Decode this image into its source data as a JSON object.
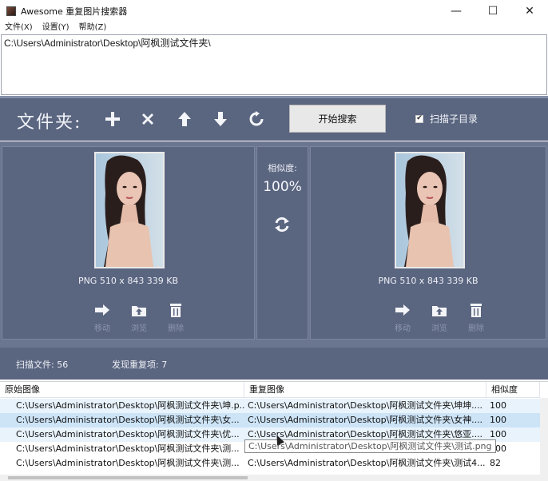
{
  "window": {
    "title": "Awesome 重复图片搜索器",
    "minimize": "—",
    "maximize": "☐",
    "close": "✕"
  },
  "menu": [
    "文件(X)",
    "设置(Y)",
    "帮助(Z)"
  ],
  "folders": [
    "C:\\Users\\Administrator\\Desktop\\阿枫测试文件夹\\"
  ],
  "toolbar": {
    "label": "文件夹:",
    "search_button": "开始搜索",
    "subdir_label": "扫描子目录",
    "subdir_checked": true
  },
  "left_image": {
    "info": "PNG  510 x 843  339 KB",
    "actions": [
      "移动",
      "浏览",
      "删除"
    ]
  },
  "right_image": {
    "info": "PNG  510 x 843  339 KB",
    "actions": [
      "移动",
      "浏览",
      "删除"
    ]
  },
  "similarity": {
    "label": "相似度:",
    "value": "100%"
  },
  "status": {
    "scanned": "扫描文件:  56",
    "duplicates": "发现重复项:  7"
  },
  "table": {
    "headers": [
      "原始图像",
      "重复图像",
      "相似度"
    ],
    "rows": [
      {
        "original": "C:\\Users\\Administrator\\Desktop\\阿枫测试文件夹\\坤.p...",
        "duplicate": "C:\\Users\\Administrator\\Desktop\\阿枫测试文件夹\\坤坤....",
        "similarity": "100"
      },
      {
        "original": "C:\\Users\\Administrator\\Desktop\\阿枫测试文件夹\\女...",
        "duplicate": "C:\\Users\\Administrator\\Desktop\\阿枫测试文件夹\\女神....",
        "similarity": "100"
      },
      {
        "original": "C:\\Users\\Administrator\\Desktop\\阿枫测试文件夹\\优...",
        "duplicate": "C:\\Users\\Administrator\\Desktop\\阿枫测试文件夹\\悠亚....",
        "similarity": "100"
      },
      {
        "original": "C:\\Users\\Administrator\\Desktop\\阿枫测试文件夹\\测...",
        "duplicate": "C:\\Users\\Administrator\\Desktop\\阿枫测试文件夹\\测试.png",
        "similarity": "100"
      },
      {
        "original": "C:\\Users\\Administrator\\Desktop\\阿枫测试文件夹\\测...",
        "duplicate": "C:\\Users\\Administrator\\Desktop\\阿枫测试文件夹\\测试4...",
        "similarity": "82"
      }
    ],
    "tooltip": "C:\\Users\\Administrator\\Desktop\\阿枫测试文件夹\\测试.png"
  },
  "icons": {
    "add": "plus-icon",
    "remove": "x-icon",
    "up": "arrow-up-icon",
    "down": "arrow-down-icon",
    "reset": "refresh-icon",
    "swap": "swap-icon",
    "move": "arrow-right-icon",
    "browse": "folder-open-icon",
    "delete": "trash-icon"
  },
  "colors": {
    "panel_bg": "#5a6580",
    "selected_row": "#cde4f7"
  }
}
